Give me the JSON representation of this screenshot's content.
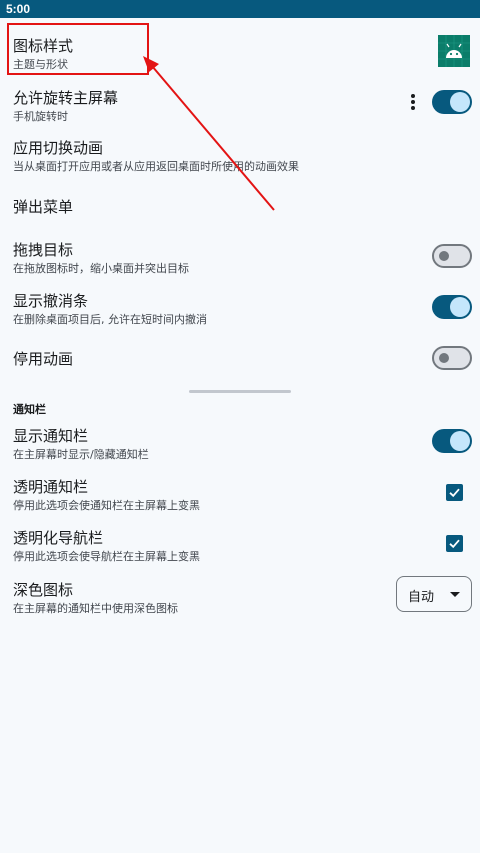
{
  "status_bar": {
    "time": "5:00"
  },
  "settings": {
    "icon_style": {
      "title": "图标样式",
      "subtitle": "主题与形状"
    },
    "allow_rotation": {
      "title": "允许旋转主屏幕",
      "subtitle": "手机旋转时",
      "checked": true
    },
    "app_transition": {
      "title": "应用切换动画",
      "subtitle": "当从桌面打开应用或者从应用返回桌面时所使用的动画效果"
    },
    "popup_menu": {
      "title": "弹出菜单"
    },
    "drag_target": {
      "title": "拖拽目标",
      "subtitle": "在拖放图标时，缩小桌面并突出目标",
      "checked": false
    },
    "show_undo": {
      "title": "显示撤消条",
      "subtitle": "在删除桌面项目后, 允许在短时间内撤消",
      "checked": true
    },
    "disable_animation": {
      "title": "停用动画",
      "checked": false
    }
  },
  "notification_section": {
    "header": "通知栏",
    "show_notification": {
      "title": "显示通知栏",
      "subtitle": "在主屏幕时显示/隐藏通知栏",
      "checked": true
    },
    "transparent_notification": {
      "title": "透明通知栏",
      "subtitle": "停用此选项会使通知栏在主屏幕上变黑",
      "checked": true
    },
    "transparent_nav": {
      "title": "透明化导航栏",
      "subtitle": "停用此选项会使导航栏在主屏幕上变黑",
      "checked": true
    },
    "dark_icons": {
      "title": "深色图标",
      "subtitle": "在主屏幕的通知栏中使用深色图标",
      "selected": "自动"
    }
  },
  "colors": {
    "accent": "#07597e",
    "switch_knob_on": "#c5e6fb",
    "annotation_red": "#e31414",
    "app_icon_bg": "#0b7d6a"
  },
  "icons": {
    "app_icon": "android-icon",
    "more": "more-vert-icon",
    "dropdown": "arrow-drop-down-icon",
    "check": "check-icon"
  }
}
